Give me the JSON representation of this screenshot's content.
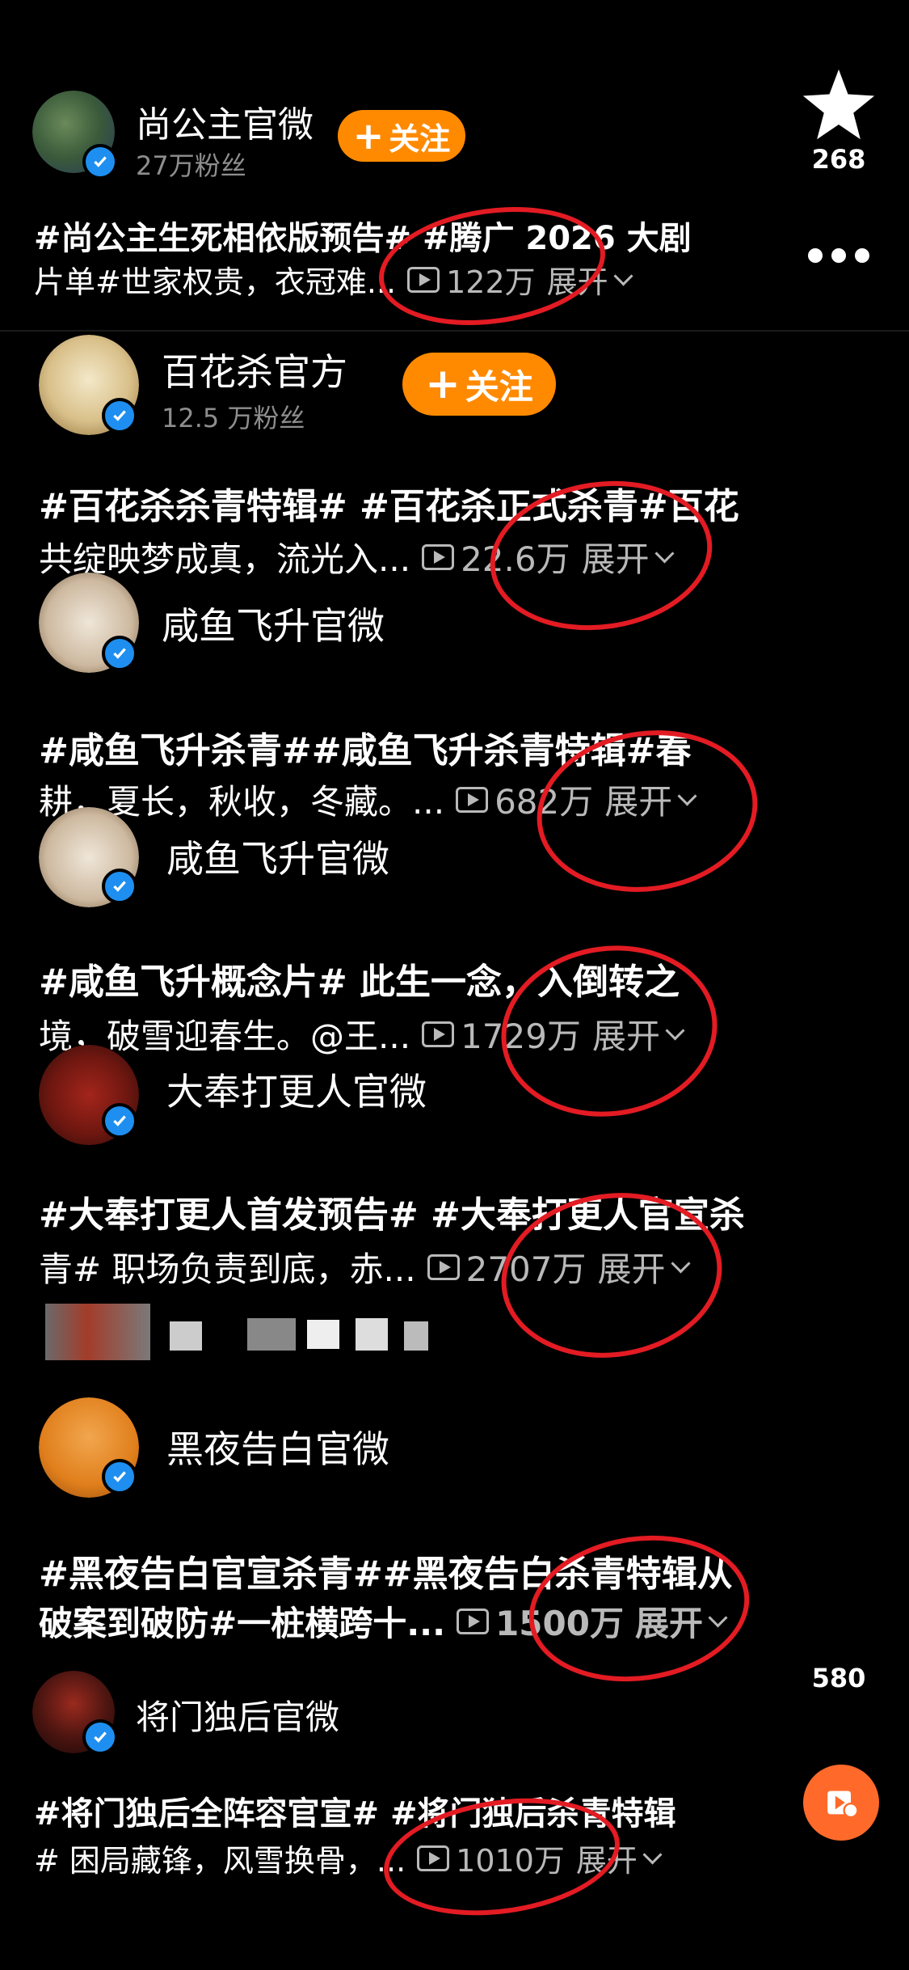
{
  "colors": {
    "accent": "#ff8a00",
    "verified": "#1e8ff0",
    "annotation": "#e31b23"
  },
  "side": {
    "star_count": "268",
    "comment_count": "580"
  },
  "posts": [
    {
      "name": "尚公主官微",
      "fans": "27万粉丝",
      "follow": "关注",
      "line1": "#尚公主生死相依版预告# #腾广 2026 大剧",
      "line2": "片单#世家权贵，衣冠难...",
      "views": "122万",
      "expand": "展开"
    },
    {
      "name": "百花杀官方",
      "fans": "12.5 万粉丝",
      "follow": "关注",
      "line1": "#百花杀杀青特辑# #百花杀正式杀青#百花",
      "line2": "共绽映梦成真，流光入...",
      "views": "22.6万",
      "expand": "展开"
    },
    {
      "name": "咸鱼飞升官微",
      "line1": "#咸鱼飞升杀青##咸鱼飞升杀青特辑#春",
      "line2": "耕，夏长，秋收，冬藏。...",
      "views": "682万",
      "expand": "展开"
    },
    {
      "name": "咸鱼飞升官微",
      "line1": "#咸鱼飞升概念片# 此生一念，入倒转之",
      "line2": "境，破雪迎春生。@王...",
      "views": "1729万",
      "expand": "展开"
    },
    {
      "name": "大奉打更人官微",
      "line1": "#大奉打更人首发预告# #大奉打更人官宣杀",
      "line2": "青# 职场负责到底，赤...",
      "views": "2707万",
      "expand": "展开"
    },
    {
      "name": "黑夜告白官微",
      "line1": "#黑夜告白官宣杀青##黑夜告白杀青特辑从",
      "line2": "破案到破防#一桩横跨十...",
      "views": "1500万",
      "expand": "展开"
    },
    {
      "name": "将门独后官微",
      "line1": "#将门独后全阵容官宣# #将门独后杀青特辑",
      "line2": "# 困局藏锋，风雪换骨，...",
      "views": "1010万",
      "expand": "展开"
    }
  ],
  "icons": {
    "star": "star-icon",
    "more": "more-icon",
    "video": "play-icon",
    "verified": "verified-badge-icon",
    "share": "share-video-icon"
  }
}
